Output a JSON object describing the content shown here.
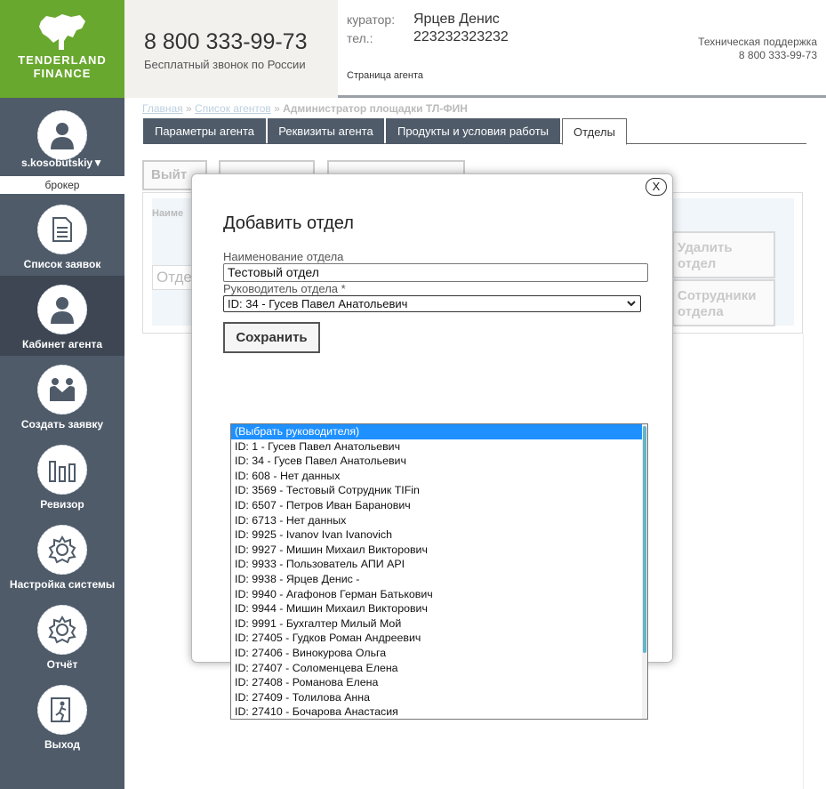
{
  "brand": {
    "line1": "TENDERLAND",
    "line2": "FINANCE"
  },
  "user": {
    "name": "s.kosobutskiy▼",
    "role": "брокер"
  },
  "sidebar": {
    "items": [
      {
        "label": "Список заявок",
        "icon": "document-icon"
      },
      {
        "label": "Кабинет агента",
        "icon": "user-icon"
      },
      {
        "label": "Создать заявку",
        "icon": "handshake-icon"
      },
      {
        "label": "Ревизор",
        "icon": "bar-chart-icon"
      },
      {
        "label": "Настройка системы",
        "icon": "gear-icon"
      },
      {
        "label": "Отчёт",
        "icon": "gear-icon"
      },
      {
        "label": "Выход",
        "icon": "exit-icon"
      }
    ]
  },
  "header": {
    "phone": "8 800 333-99-73",
    "phone_note": "Бесплатный звонок по России",
    "curator_label": "куратор:",
    "curator_name": "Ярцев Денис",
    "tel_label": "тел.:",
    "tel_value": "223232323232",
    "page_label": "Страница агента",
    "support_label": "Техническая поддержка",
    "support_phone": "8 800 333-99-73"
  },
  "breadcrumb": {
    "home": "Главная",
    "sep": " » ",
    "agents": "Список агентов",
    "current": "Администратор площадки ТЛ-ФИН"
  },
  "tabs": [
    "Параметры агента",
    "Реквизиты агента",
    "Продукты и условия работы",
    "Отделы"
  ],
  "background": {
    "exit_btn": "Выйт",
    "name_label": "Наиме",
    "dept_placeholder": "Отде",
    "delete_line1": "Удалить",
    "delete_line2": "отдел",
    "staff_line1": "Сотрудники",
    "staff_line2": "отдела"
  },
  "modal": {
    "close": "X",
    "title": "Добавить отдел",
    "name_label": "Наименование отдела",
    "name_value": "Тестовый отдел",
    "head_label": "Руководитель отдела *",
    "head_value": "ID: 34 - Гусев Павел Анатольевич",
    "save": "Сохранить"
  },
  "dropdown": {
    "options": [
      "(Выбрать руководителя)",
      "ID: 1 - Гусев Павел Анатольевич",
      "ID: 34 - Гусев Павел Анатольевич",
      "ID: 608 - Нет данных",
      "ID: 3569 - Тестовый Сотрудник TIFin",
      "ID: 6507 - Петров Иван Баранович",
      "ID: 6713 - Нет данных",
      "ID: 9925 - Ivanov Ivan Ivanovich",
      "ID: 9927 - Мишин Михаил Викторович",
      "ID: 9933 - Пользователь АПИ API",
      "ID: 9938 - Ярцев Денис -",
      "ID: 9940 - Агафонов Герман Батькович",
      "ID: 9944 - Мишин Михаил Викторович",
      "ID: 9991 - Бухгалтер Милый Мой",
      "ID: 27405 - Гудков Роман Андреевич",
      "ID: 27406 - Винокурова Ольга",
      "ID: 27407 - Соломенцева Елена",
      "ID: 27408 - Романова Елена",
      "ID: 27409 - Толилова Анна",
      "ID: 27410 - Бочарова Анастасия"
    ],
    "highlighted_index": 0
  },
  "colors": {
    "brand_green": "#69a82f",
    "sidebar": "#4f5b69",
    "sidebar_active": "#3d4652",
    "highlight": "#1e90ff"
  }
}
